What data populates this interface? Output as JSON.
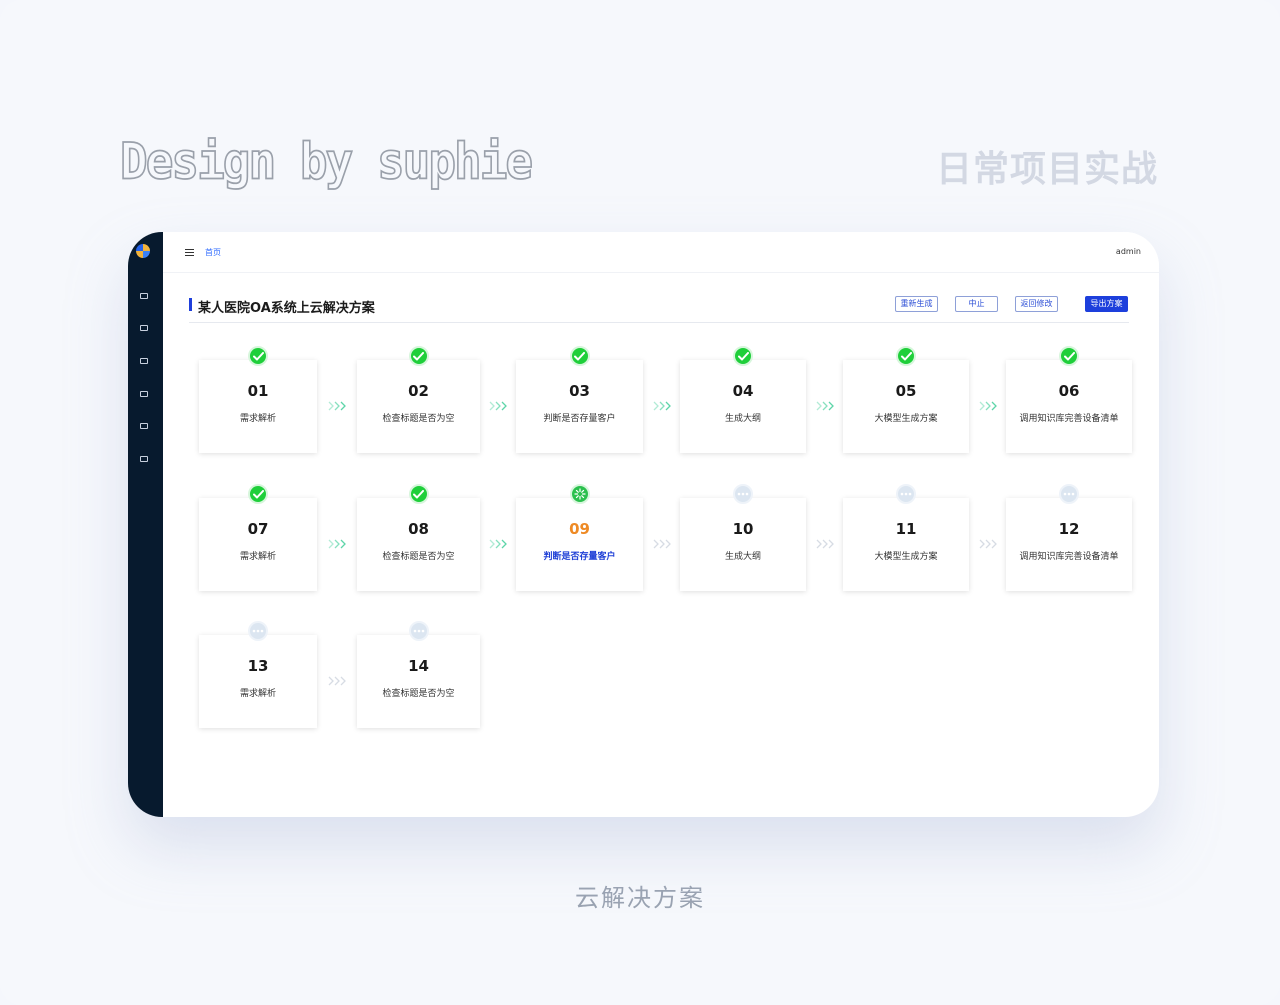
{
  "hero": {
    "title": "Design by suphie",
    "subtitle": "日常项目实战"
  },
  "caption": "云解决方案",
  "topbar": {
    "breadcrumb_home": "首页",
    "user": "admin"
  },
  "page": {
    "title": "某人医院OA系统上云解决方案"
  },
  "buttons": {
    "regenerate": "重新生成",
    "stop": "中止",
    "back_edit": "返回修改",
    "export": "导出方案"
  },
  "colors": {
    "accent": "#1d3fdc",
    "done": "#1fcf3a",
    "active_number": "#ee8a25",
    "sidebar": "#071a2e"
  },
  "steps": [
    {
      "num": "01",
      "label": "需求解析",
      "status": "done"
    },
    {
      "num": "02",
      "label": "检查标题是否为空",
      "status": "done"
    },
    {
      "num": "03",
      "label": "判断是否存量客户",
      "status": "done"
    },
    {
      "num": "04",
      "label": "生成大纲",
      "status": "done"
    },
    {
      "num": "05",
      "label": "大模型生成方案",
      "status": "done"
    },
    {
      "num": "06",
      "label": "调用知识库完善设备清单",
      "status": "done"
    },
    {
      "num": "07",
      "label": "需求解析",
      "status": "done"
    },
    {
      "num": "08",
      "label": "检查标题是否为空",
      "status": "done"
    },
    {
      "num": "09",
      "label": "判断是否存量客户",
      "status": "loading"
    },
    {
      "num": "10",
      "label": "生成大纲",
      "status": "pending"
    },
    {
      "num": "11",
      "label": "大模型生成方案",
      "status": "pending"
    },
    {
      "num": "12",
      "label": "调用知识库完善设备清单",
      "status": "pending"
    },
    {
      "num": "13",
      "label": "需求解析",
      "status": "pending"
    },
    {
      "num": "14",
      "label": "检查标题是否为空",
      "status": "pending"
    }
  ]
}
